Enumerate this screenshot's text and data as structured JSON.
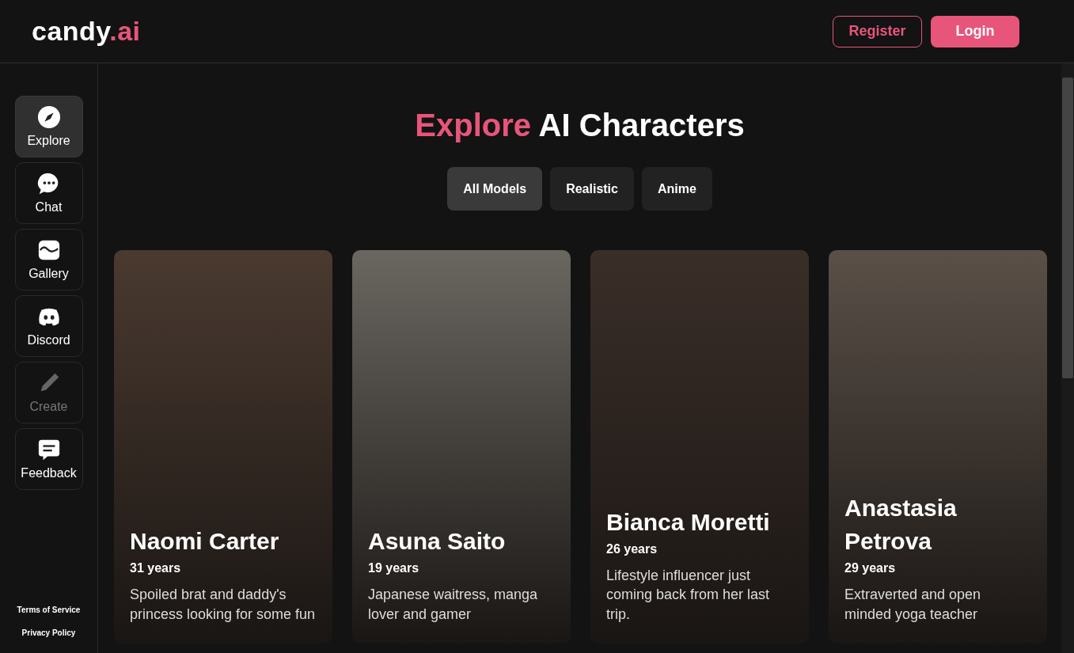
{
  "header": {
    "logo": {
      "name": "candy",
      "suffix": ".ai"
    },
    "buttons": [
      {
        "label": "Register",
        "kind": "outline"
      },
      {
        "label": "Login",
        "kind": "filled"
      }
    ]
  },
  "sidebar": {
    "items": [
      {
        "label": "Explore",
        "selected": true,
        "disabled": false
      },
      {
        "label": "Chat",
        "selected": false,
        "disabled": false
      },
      {
        "label": "Gallery",
        "selected": false,
        "disabled": false
      },
      {
        "label": "Discord",
        "selected": false,
        "disabled": false
      },
      {
        "label": "Create",
        "selected": false,
        "disabled": true
      },
      {
        "label": "Feedback",
        "selected": false,
        "disabled": false
      }
    ],
    "links": [
      "Terms of Service",
      "Privacy Policy"
    ]
  },
  "heading": {
    "accent": "Explore",
    "rest": "AI Characters"
  },
  "filters": [
    {
      "label": "All Models",
      "selected": true
    },
    {
      "label": "Realistic",
      "selected": false
    },
    {
      "label": "Anime",
      "selected": false
    }
  ],
  "characters": [
    {
      "name": "Naomi Carter",
      "age": "31 years",
      "description": "Spoiled brat and daddy's princess looking for some fun"
    },
    {
      "name": "Asuna Saito",
      "age": "19 years",
      "description": "Japanese waitress, manga lover and gamer"
    },
    {
      "name": "Bianca Moretti",
      "age": "26 years",
      "description": "Lifestyle influencer just coming back from her last trip."
    },
    {
      "name": "Anastasia Petrova",
      "age": "29 years",
      "description": "Extraverted and open minded yoga teacher"
    }
  ]
}
